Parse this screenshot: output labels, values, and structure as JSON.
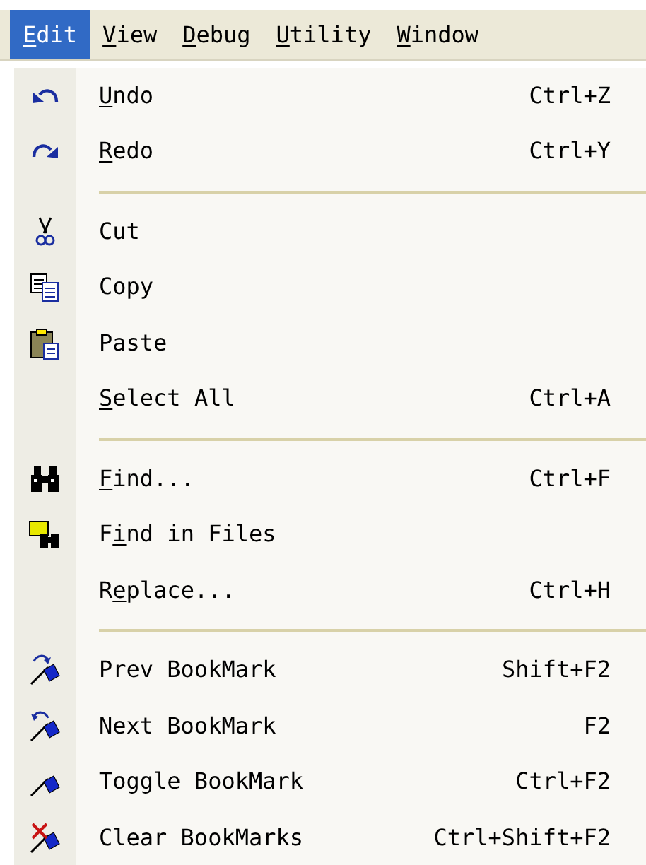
{
  "menu_bar": [
    {
      "key": "E",
      "after": "dit",
      "selected": true
    },
    {
      "key": "V",
      "after": "iew",
      "selected": false
    },
    {
      "key": "D",
      "after": "ebug",
      "selected": false
    },
    {
      "key": "U",
      "after": "tility",
      "selected": false
    },
    {
      "key": "W",
      "after": "indow",
      "selected": false
    }
  ],
  "menu": [
    {
      "kind": "item",
      "key": "U",
      "after": "ndo",
      "shortcut": "Ctrl+Z"
    },
    {
      "kind": "item",
      "key": "R",
      "after": "edo",
      "shortcut": "Ctrl+Y"
    },
    {
      "kind": "separator"
    },
    {
      "kind": "item",
      "label": "Cut"
    },
    {
      "kind": "item",
      "label": "Copy"
    },
    {
      "kind": "item",
      "label": "Paste"
    },
    {
      "kind": "item",
      "key": "S",
      "after": "elect All",
      "shortcut": "Ctrl+A"
    },
    {
      "kind": "separator"
    },
    {
      "kind": "item",
      "key": "F",
      "after": "ind...",
      "shortcut": "Ctrl+F"
    },
    {
      "kind": "item",
      "before": "F",
      "key": "i",
      "after": "nd in Files"
    },
    {
      "kind": "item",
      "before": "R",
      "key": "e",
      "after": "place...",
      "shortcut": "Ctrl+H"
    },
    {
      "kind": "separator"
    },
    {
      "kind": "item",
      "label": "Prev BookMark",
      "shortcut": "Shift+F2"
    },
    {
      "kind": "item",
      "label": "Next BookMark",
      "shortcut": "F2"
    },
    {
      "kind": "item",
      "label": "Toggle BookMark",
      "shortcut": "Ctrl+F2"
    },
    {
      "kind": "item",
      "label": "Clear BookMarks",
      "shortcut": "Ctrl+Shift+F2"
    }
  ]
}
